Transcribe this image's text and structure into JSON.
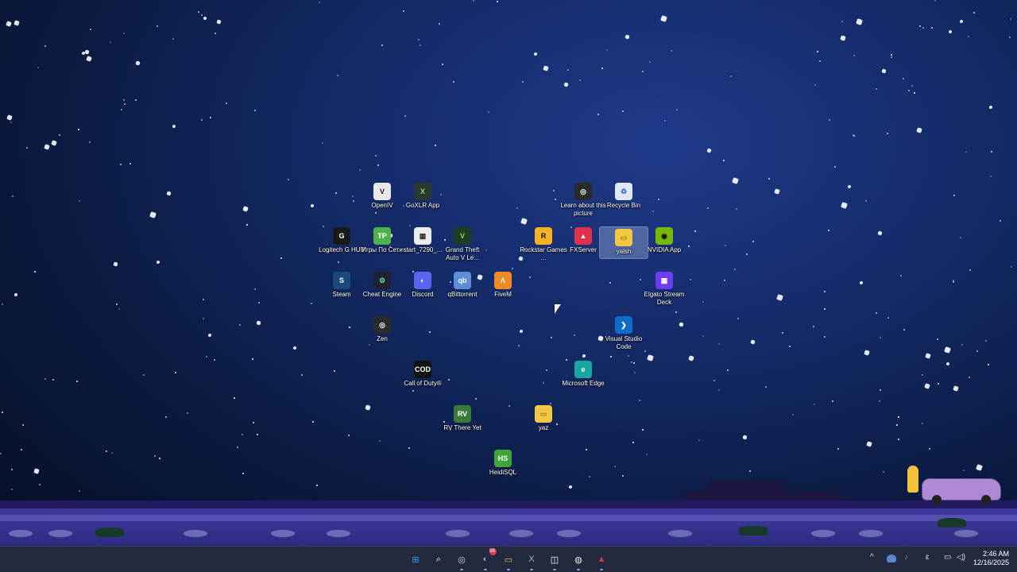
{
  "desktop": {
    "icons": [
      {
        "label": "OpenIV",
        "glyph": "V",
        "bg": "#e8e8e8",
        "fg": "#222",
        "shortcut": false
      },
      {
        "label": "GoXLR App",
        "glyph": "X",
        "bg": "#2b3a2f",
        "fg": "#8dd18d",
        "shortcut": false
      },
      {
        "label": "Learn about this picture",
        "glyph": "◎",
        "bg": "#2a2a2a",
        "fg": "#fff",
        "shortcut": false
      },
      {
        "label": "Recycle Bin",
        "glyph": "♻",
        "bg": "#dfe8f5",
        "fg": "#3b6fc9",
        "shortcut": false
      },
      {
        "label": "Logitech G HUB",
        "glyph": "G",
        "bg": "#1a1a1a",
        "fg": "#fff",
        "shortcut": true
      },
      {
        "label": "Игры По Сети",
        "glyph": "TP",
        "bg": "#4fb14b",
        "fg": "#fff",
        "shortcut": true
      },
      {
        "label": "start_7290_...",
        "glyph": "▦",
        "bg": "#ececec",
        "fg": "#333",
        "shortcut": true
      },
      {
        "label": "Grand Theft Auto V Le...",
        "glyph": "V",
        "bg": "#1f3d22",
        "fg": "#9bd36b",
        "shortcut": true
      },
      {
        "label": "Rockstar Games ...",
        "glyph": "R",
        "bg": "#f4b323",
        "fg": "#111",
        "shortcut": true
      },
      {
        "label": "FXServer",
        "glyph": "▲",
        "bg": "#e0314a",
        "fg": "#fff",
        "shortcut": true
      },
      {
        "label": "yalsh",
        "glyph": "▭",
        "bg": "#f2c744",
        "fg": "#a57a12",
        "shortcut": true
      },
      {
        "label": "NVIDIA App",
        "glyph": "◉",
        "bg": "#76b900",
        "fg": "#111",
        "shortcut": false
      },
      {
        "label": "Steam",
        "glyph": "S",
        "bg": "#1b4a7a",
        "fg": "#fff",
        "shortcut": true
      },
      {
        "label": "Cheat Engine",
        "glyph": "⚙",
        "bg": "#1d2333",
        "fg": "#6cd2a6",
        "shortcut": true
      },
      {
        "label": "Discord",
        "glyph": "◐",
        "bg": "#5865f2",
        "fg": "#fff",
        "shortcut": false
      },
      {
        "label": "qBittorrent",
        "glyph": "qb",
        "bg": "#5c8ed8",
        "fg": "#fff",
        "shortcut": true
      },
      {
        "label": "FiveM",
        "glyph": "Λ",
        "bg": "#f08a24",
        "fg": "#fff",
        "shortcut": true
      },
      {
        "label": "Elgato Stream Deck",
        "glyph": "▦",
        "bg": "#6d3bf2",
        "fg": "#fff",
        "shortcut": false
      },
      {
        "label": "Zen",
        "glyph": "◎",
        "bg": "#2a2a2a",
        "fg": "#fff",
        "shortcut": false
      },
      {
        "label": "Visual Studio Code",
        "glyph": "❯",
        "bg": "#0f6cc7",
        "fg": "#fff",
        "shortcut": false
      },
      {
        "label": "Call of Duty®",
        "glyph": "COD",
        "bg": "#111",
        "fg": "#fff",
        "shortcut": false
      },
      {
        "label": "Microsoft Edge",
        "glyph": "e",
        "bg": "#1aa6a0",
        "fg": "#fff",
        "shortcut": true
      },
      {
        "label": "RV There Yet",
        "glyph": "RV",
        "bg": "#3b7a3a",
        "fg": "#fff",
        "shortcut": true
      },
      {
        "label": "yaz",
        "glyph": "▭",
        "bg": "#f2c744",
        "fg": "#a57a12",
        "shortcut": false
      },
      {
        "label": "HeidiSQL",
        "glyph": "HS",
        "bg": "#3ea53a",
        "fg": "#fff",
        "shortcut": true
      }
    ]
  },
  "taskbar": {
    "apps": [
      {
        "name": "start-button",
        "glyph": "⊞",
        "color": "#3aa0ff"
      },
      {
        "name": "search-icon",
        "glyph": "⌕",
        "color": "#ffffff"
      },
      {
        "name": "zen-taskbar-icon",
        "glyph": "◎",
        "color": "#cfd6e6"
      },
      {
        "name": "discord-taskbar-icon",
        "glyph": "◐",
        "color": "#8a93ff",
        "badge": "99"
      },
      {
        "name": "file-explorer-icon",
        "glyph": "▭",
        "color": "#f2c744"
      },
      {
        "name": "goxlr-taskbar-icon",
        "glyph": "X",
        "color": "#6fc8a0"
      },
      {
        "name": "store-icon",
        "glyph": "◫",
        "color": "#ffffff"
      },
      {
        "name": "obs-taskbar-icon",
        "glyph": "◍",
        "color": "#e8e8e8"
      },
      {
        "name": "fxserver-taskbar-icon",
        "glyph": "▲",
        "color": "#e0314a"
      }
    ],
    "tray": {
      "chevron": "^",
      "language": "ε",
      "time": "2:46 AM",
      "date": "12/16/2025"
    }
  }
}
